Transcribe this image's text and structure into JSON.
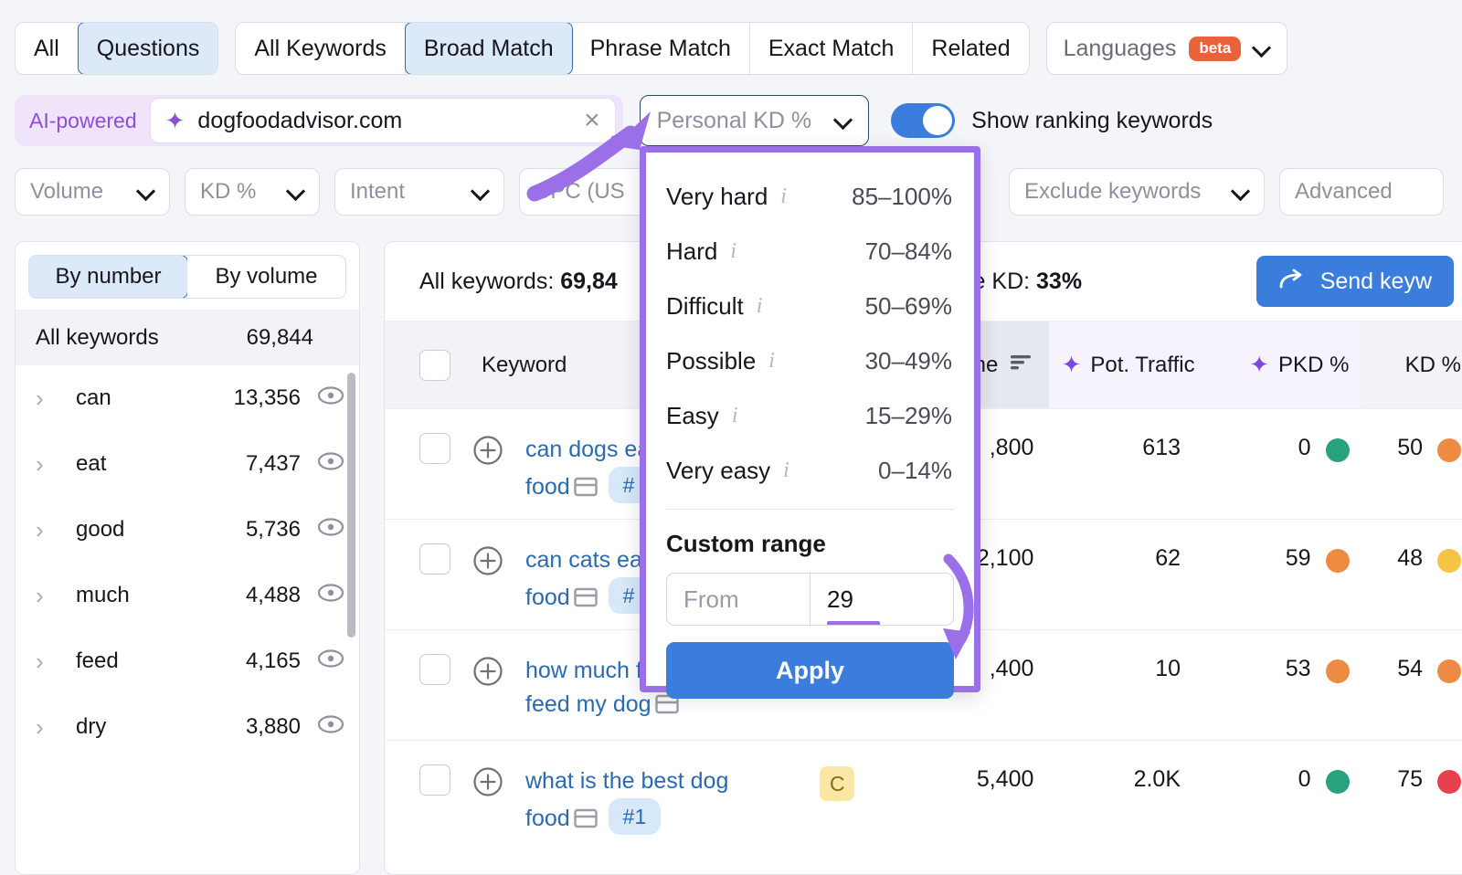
{
  "match_tabs": {
    "group1": [
      {
        "label": "All",
        "active": false
      },
      {
        "label": "Questions",
        "active": true
      }
    ],
    "group2": [
      {
        "label": "All Keywords",
        "active": false
      },
      {
        "label": "Broad Match",
        "active": true
      },
      {
        "label": "Phrase Match",
        "active": false
      },
      {
        "label": "Exact Match",
        "active": false
      },
      {
        "label": "Related",
        "active": false
      }
    ],
    "languages": {
      "label": "Languages",
      "badge": "beta"
    }
  },
  "search": {
    "ai_label": "AI-powered",
    "value": "dogfoodadvisor.com",
    "clear": "×",
    "spark": "sparkle-icon"
  },
  "pkd_button": {
    "label": "Personal KD %"
  },
  "ranking_toggle": {
    "label": "Show ranking keywords",
    "on": true
  },
  "filters": [
    {
      "label": "Volume"
    },
    {
      "label": "KD %"
    },
    {
      "label": "Intent"
    },
    {
      "label": "CPC (US"
    },
    {
      "label": "Exclude keywords"
    },
    {
      "label": "Advanced"
    }
  ],
  "left_panel": {
    "segments": [
      {
        "label": "By number",
        "active": true
      },
      {
        "label": "By volume",
        "active": false
      }
    ],
    "all_row": {
      "label": "All keywords",
      "count": "69,844"
    },
    "items": [
      {
        "label": "can",
        "count": "13,356"
      },
      {
        "label": "eat",
        "count": "7,437"
      },
      {
        "label": "good",
        "count": "5,736"
      },
      {
        "label": "much",
        "count": "4,488"
      },
      {
        "label": "feed",
        "count": "4,165"
      },
      {
        "label": "dry",
        "count": "3,880"
      }
    ]
  },
  "table_header_bar": {
    "all_keywords_label": "All keywords:",
    "all_keywords_value": "69,84",
    "average_kd_label": "Average KD:",
    "average_kd_value": "33%",
    "send_button": "Send keyw"
  },
  "columns": {
    "keyword": "Keyword",
    "intent": "",
    "volume": "ne",
    "pot_traffic": "Pot. Traffic",
    "pkd": "PKD %",
    "kd": "KD %"
  },
  "rows": [
    {
      "keyword_line1": "can dogs ea",
      "keyword_line2": "food",
      "page_chip": "#",
      "intent": "",
      "volume": ",800",
      "pot_traffic": "613",
      "pkd": "0",
      "pkd_color": "#27a17e",
      "kd": "50",
      "kd_color": "#ee8b43"
    },
    {
      "keyword_line1": "can cats ea",
      "keyword_line2": "food",
      "page_chip": "#",
      "intent": "",
      "volume": "2,100",
      "pot_traffic": "62",
      "pkd": "59",
      "pkd_color": "#ee8b43",
      "kd": "48",
      "kd_color": "#f5c445"
    },
    {
      "keyword_line1": "how much f",
      "keyword_line2": "feed my dog",
      "page_chip": "",
      "intent": "",
      "volume": ",400",
      "pot_traffic": "10",
      "pkd": "53",
      "pkd_color": "#ee8b43",
      "kd": "54",
      "kd_color": "#ee8b43"
    },
    {
      "keyword_line1": "what is the best dog",
      "keyword_line2": "food",
      "page_chip": "#1",
      "intent": "C",
      "volume": "5,400",
      "pot_traffic": "2.0K",
      "pkd": "0",
      "pkd_color": "#27a17e",
      "kd": "75",
      "kd_color": "#e8404f"
    }
  ],
  "dropdown": {
    "levels": [
      {
        "name": "Very hard",
        "range": "85–100%"
      },
      {
        "name": "Hard",
        "range": "70–84%"
      },
      {
        "name": "Difficult",
        "range": "50–69%"
      },
      {
        "name": "Possible",
        "range": "30–49%"
      },
      {
        "name": "Easy",
        "range": "15–29%"
      },
      {
        "name": "Very easy",
        "range": "0–14%"
      }
    ],
    "custom_range_title": "Custom range",
    "from_placeholder": "From",
    "to_value": "29",
    "apply_label": "Apply"
  },
  "annotation": {
    "color": "#9b6fe8"
  }
}
